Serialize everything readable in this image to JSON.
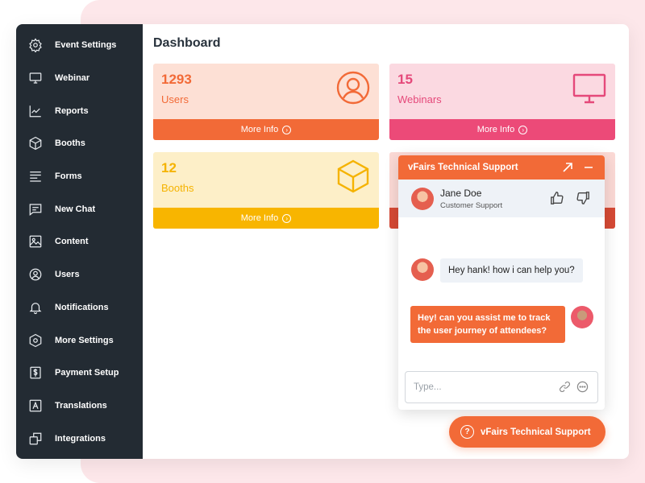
{
  "sidebar": {
    "items": [
      {
        "label": "Event Settings",
        "icon": "gear-icon"
      },
      {
        "label": "Webinar",
        "icon": "monitor-icon"
      },
      {
        "label": "Reports",
        "icon": "chart-icon"
      },
      {
        "label": "Booths",
        "icon": "cube-icon"
      },
      {
        "label": "Forms",
        "icon": "form-icon"
      },
      {
        "label": "New Chat",
        "icon": "chat-icon"
      },
      {
        "label": "Content",
        "icon": "image-icon"
      },
      {
        "label": "Users",
        "icon": "user-icon"
      },
      {
        "label": "Notifications",
        "icon": "bell-icon"
      },
      {
        "label": "More Settings",
        "icon": "hexagon-icon"
      },
      {
        "label": "Payment Setup",
        "icon": "dollar-icon"
      },
      {
        "label": "Translations",
        "icon": "translate-icon"
      },
      {
        "label": "Integrations",
        "icon": "integrations-icon"
      }
    ]
  },
  "main": {
    "title": "Dashboard",
    "cards": [
      {
        "value": "1293",
        "label": "Users",
        "more": "More Info",
        "icon": "user-circle-icon",
        "bg": "#fde0d5",
        "accent": "#f26a37",
        "button": "#f26a37"
      },
      {
        "value": "15",
        "label": "Webinars",
        "more": "More Info",
        "icon": "monitor-icon",
        "bg": "#fbd9e1",
        "accent": "#e5497a",
        "button": "#ec4a78"
      },
      {
        "value": "12",
        "label": "Booths",
        "more": "More Info",
        "icon": "cube-icon",
        "bg": "#fdefc8",
        "accent": "#f5b301",
        "button": "#f8b500"
      },
      {
        "value": "",
        "label": "",
        "more": "",
        "icon": "",
        "bg": "#fbd9d5",
        "accent": "#d74a33",
        "button": "#d64a35"
      }
    ]
  },
  "chat": {
    "title": "vFairs Technical Support",
    "agent_name": "Jane Doe",
    "agent_role": "Customer Support",
    "messages": [
      {
        "from": "agent",
        "text": "Hey hank! how i can help you?"
      },
      {
        "from": "user",
        "text": "Hey! can you assist me to track the user journey of attendees?"
      }
    ],
    "input_placeholder": "Type..."
  },
  "support_button": {
    "label": "vFairs Technical Support"
  },
  "colors": {
    "brand": "#f26a37",
    "sidebar": "#232b33"
  }
}
